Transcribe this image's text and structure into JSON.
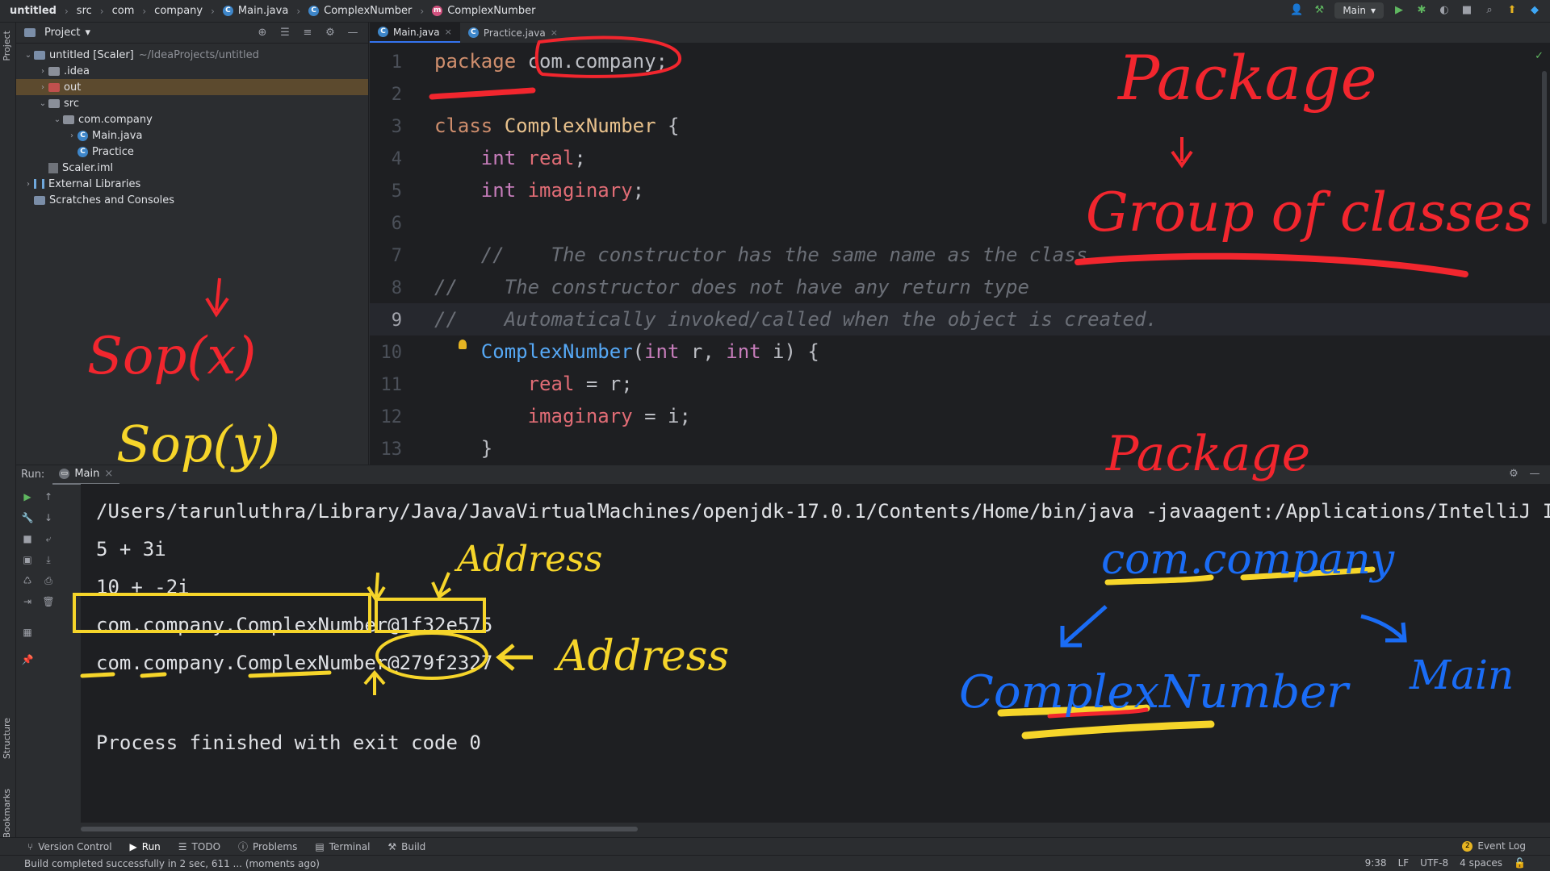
{
  "breadcrumb": [
    "untitled",
    "src",
    "com",
    "company",
    "Main.java",
    "ComplexNumber",
    "ComplexNumber"
  ],
  "toolbar": {
    "run_config": "Main"
  },
  "project_panel": {
    "title": "Project",
    "tree": [
      {
        "label": "untitled [Scaler]",
        "extra": "~/IdeaProjects/untitled",
        "indent": 0,
        "chev": "v",
        "icon": "module"
      },
      {
        "label": ".idea",
        "extra": "",
        "indent": 1,
        "chev": ">",
        "icon": "folder"
      },
      {
        "label": "out",
        "extra": "",
        "indent": 1,
        "chev": ">",
        "icon": "folder-red"
      },
      {
        "label": "src",
        "extra": "",
        "indent": 1,
        "chev": "v",
        "icon": "folder"
      },
      {
        "label": "com.company",
        "extra": "",
        "indent": 2,
        "chev": "v",
        "icon": "folder"
      },
      {
        "label": "Main.java",
        "extra": "",
        "indent": 3,
        "chev": ">",
        "icon": "class"
      },
      {
        "label": "Practice",
        "extra": "",
        "indent": 3,
        "chev": "",
        "icon": "class"
      },
      {
        "label": "Scaler.iml",
        "extra": "",
        "indent": 1,
        "chev": "",
        "icon": "file"
      },
      {
        "label": "External Libraries",
        "extra": "",
        "indent": 0,
        "chev": ">",
        "icon": "lib"
      },
      {
        "label": "Scratches and Consoles",
        "extra": "",
        "indent": 0,
        "chev": "",
        "icon": "scratch"
      }
    ]
  },
  "editor": {
    "tabs": [
      {
        "label": "Main.java",
        "active": true
      },
      {
        "label": "Practice.java",
        "active": false
      }
    ],
    "lines": [
      {
        "n": "1",
        "tokens": [
          [
            "kw",
            "package "
          ],
          [
            "pl",
            "com.company;"
          ]
        ]
      },
      {
        "n": "2",
        "tokens": []
      },
      {
        "n": "3",
        "tokens": [
          [
            "kw",
            "class "
          ],
          [
            "cls",
            "ComplexNumber "
          ],
          [
            "pl",
            "{"
          ]
        ]
      },
      {
        "n": "4",
        "tokens": [
          [
            "pl",
            "    "
          ],
          [
            "kw2",
            "int "
          ],
          [
            "fld",
            "real"
          ],
          [
            "pl",
            ";"
          ]
        ]
      },
      {
        "n": "5",
        "tokens": [
          [
            "pl",
            "    "
          ],
          [
            "kw2",
            "int "
          ],
          [
            "fld",
            "imaginary"
          ],
          [
            "pl",
            ";"
          ]
        ]
      },
      {
        "n": "6",
        "tokens": []
      },
      {
        "n": "7",
        "tokens": [
          [
            "cm",
            "    //    The constructor has the same name as the class"
          ]
        ]
      },
      {
        "n": "8",
        "tokens": [
          [
            "cm",
            "//    The constructor does not have any return type"
          ]
        ]
      },
      {
        "n": "9",
        "tokens": [
          [
            "cm",
            "//    Automatically invoked/called when the object is created."
          ]
        ],
        "current": true
      },
      {
        "n": "10",
        "tokens": [
          [
            "pl",
            "    "
          ],
          [
            "fn",
            "ComplexNumber"
          ],
          [
            "pl",
            "("
          ],
          [
            "kw2",
            "int "
          ],
          [
            "pl",
            "r, "
          ],
          [
            "kw2",
            "int "
          ],
          [
            "pl",
            "i) {"
          ]
        ]
      },
      {
        "n": "11",
        "tokens": [
          [
            "pl",
            "        "
          ],
          [
            "fld",
            "real "
          ],
          [
            "pl",
            "= r;"
          ]
        ]
      },
      {
        "n": "12",
        "tokens": [
          [
            "pl",
            "        "
          ],
          [
            "fld",
            "imaginary "
          ],
          [
            "pl",
            "= i;"
          ]
        ]
      },
      {
        "n": "13",
        "tokens": [
          [
            "pl",
            "    }"
          ]
        ]
      }
    ]
  },
  "run": {
    "label": "Run:",
    "tab": "Main",
    "output": [
      "/Users/tarunluthra/Library/Java/JavaVirtualMachines/openjdk-17.0.1/Contents/Home/bin/java -javaagent:/Applications/IntelliJ ID",
      "5 + 3i",
      "10 + -2i",
      "com.company.ComplexNumber@1f32e575",
      "com.company.ComplexNumber@279f2327",
      "",
      "Process finished with exit code 0"
    ]
  },
  "bottom_tools": [
    "Version Control",
    "Run",
    "TODO",
    "Problems",
    "Terminal",
    "Build"
  ],
  "event_log": {
    "count": "2",
    "label": "Event Log"
  },
  "status": {
    "message": "Build completed successfully in 2 sec, 611 ... (moments ago)",
    "position": "9:38",
    "line_sep": "LF",
    "encoding": "UTF-8",
    "indent": "4 spaces"
  },
  "side_labels": {
    "project": "Project",
    "structure": "Structure",
    "bookmarks": "Bookmarks"
  },
  "annotations": {
    "package_top": "Package",
    "group_of_classes": "Group of classes",
    "sop_x": "Sop(x)",
    "sop_y": "Sop(y)",
    "package_mid": "Package",
    "address_1": "Address",
    "address_2": "Address",
    "com_company": "com.company",
    "complex_number": "ComplexNumber",
    "main": "Main"
  },
  "colors": {
    "accent": "#3574f0",
    "annotation_red": "#f2262e",
    "annotation_yellow": "#f6d52a",
    "annotation_blue": "#1a6cf5"
  }
}
